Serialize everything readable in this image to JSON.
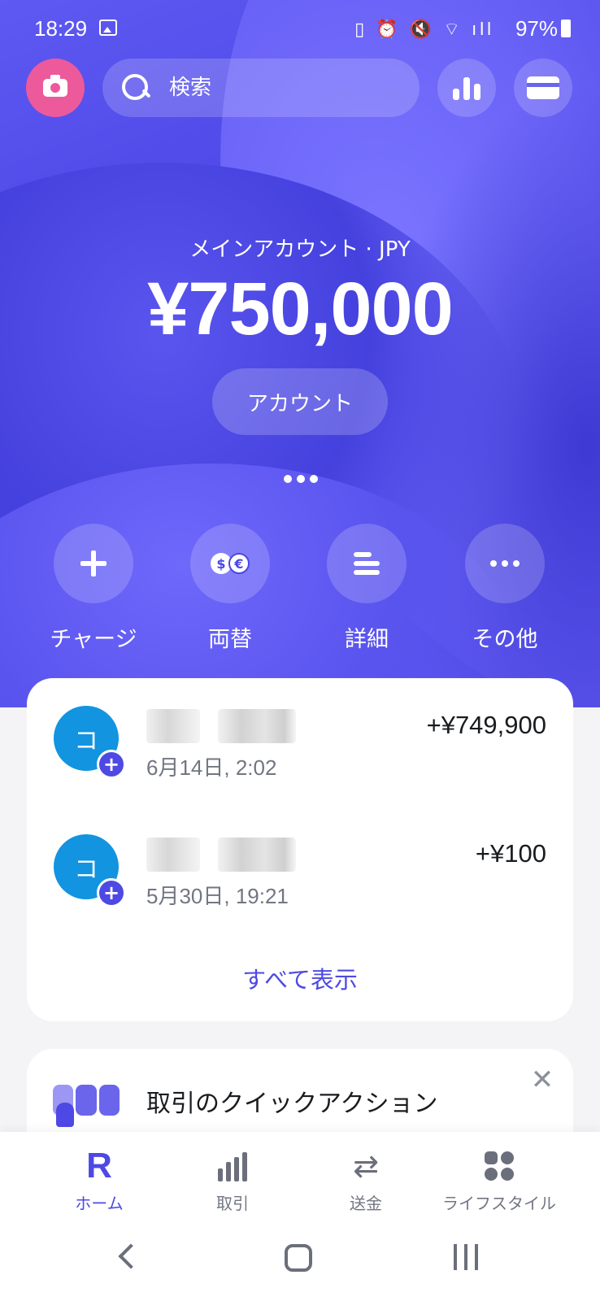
{
  "status_bar": {
    "time": "18:29",
    "battery": "97%",
    "system_icons": "▯ ⏰ 🔇 ⌔ ıll"
  },
  "search": {
    "placeholder": "検索"
  },
  "balance": {
    "account_label": "メインアカウント · JPY",
    "amount": "¥750,000",
    "account_button": "アカウント"
  },
  "actions": [
    {
      "label": "チャージ",
      "icon": "plus-icon"
    },
    {
      "label": "両替",
      "icon": "currency-exchange-icon",
      "glyph_a": "$",
      "glyph_b": "€"
    },
    {
      "label": "詳細",
      "icon": "details-list-icon"
    },
    {
      "label": "その他",
      "icon": "more-icon"
    }
  ],
  "transactions": [
    {
      "avatar_letter": "コ",
      "date": "6月14日, 2:02",
      "amount": "+¥749,900"
    },
    {
      "avatar_letter": "コ",
      "date": "5月30日, 19:21",
      "amount": "+¥100"
    }
  ],
  "transactions_see_all": "すべて表示",
  "promo": {
    "title": "取引のクイックアクション",
    "close": "✕"
  },
  "bottom_nav": [
    {
      "label": "ホーム",
      "icon": "revolut-r-icon",
      "glyph": "R",
      "active": true
    },
    {
      "label": "取引",
      "icon": "transactions-bars-icon",
      "active": false
    },
    {
      "label": "送金",
      "icon": "transfer-arrows-icon",
      "glyph": "⇄",
      "active": false
    },
    {
      "label": "ライフスタイル",
      "icon": "lifestyle-grid-icon",
      "active": false
    }
  ],
  "colors": {
    "accent": "#4e49e4",
    "hero_bg": "#4b46e6",
    "camera_button": "#ec5a9b",
    "avatar": "#1294e0"
  }
}
